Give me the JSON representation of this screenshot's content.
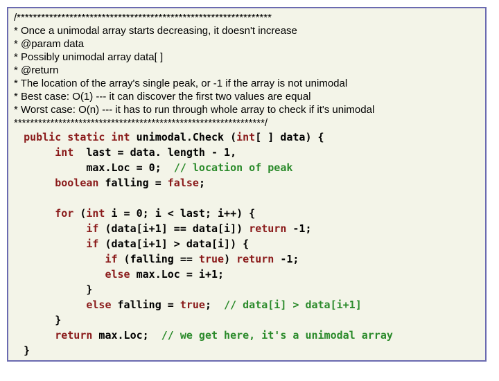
{
  "doc": {
    "top": "/***************************************************************",
    "l1": "  * Once a unimodal array starts decreasing, it doesn't increase",
    "l2": "  * @param data",
    "l3": "  * Possibly unimodal array data[ ]",
    "l4": "  * @return",
    "l5": "  * The location of the array's single peak, or -1 if the array is not unimodal",
    "l6": "  * Best case: O(1) --- it can discover the first two values are equal",
    "l7": "  * Worst case: O(n) --- it has to run through whole array to check if it's unimodal",
    "bottom": "  **************************************************************/"
  },
  "kw": {
    "public": "public",
    "static": "static",
    "int": "int",
    "boolean": "boolean",
    "false": "false",
    "true": "true",
    "for": "for",
    "if": "if",
    "else": "else",
    "return": "return"
  },
  "code": {
    "sig_name": " unimodal.Check (",
    "sig_tail": "[ ] data) {",
    "last_decl": "  last = data. length - 1,",
    "maxloc": "max.Loc = 0;  ",
    "maxloc_c": "// location of peak",
    "falling": " falling = ",
    "semi": ";",
    "for_open": " (",
    "for_i": " i = 0; i < last; i++) {",
    "if1": " (data[i+1] == data[i]) ",
    "ret_neg": " -1;",
    "if2": " (data[i+1] > data[i]) {",
    "if3": " (falling == ",
    "if3_tail": ") ",
    "else_max": " max.Loc = i+1;",
    "brace": "}",
    "else_fall": " falling = ",
    "true_semi": ";  ",
    "else_fall_c": "// data[i] > data[i+1]",
    "ret_max": " max.Loc;  ",
    "ret_max_c": "// we get here, it's a unimodal array"
  }
}
